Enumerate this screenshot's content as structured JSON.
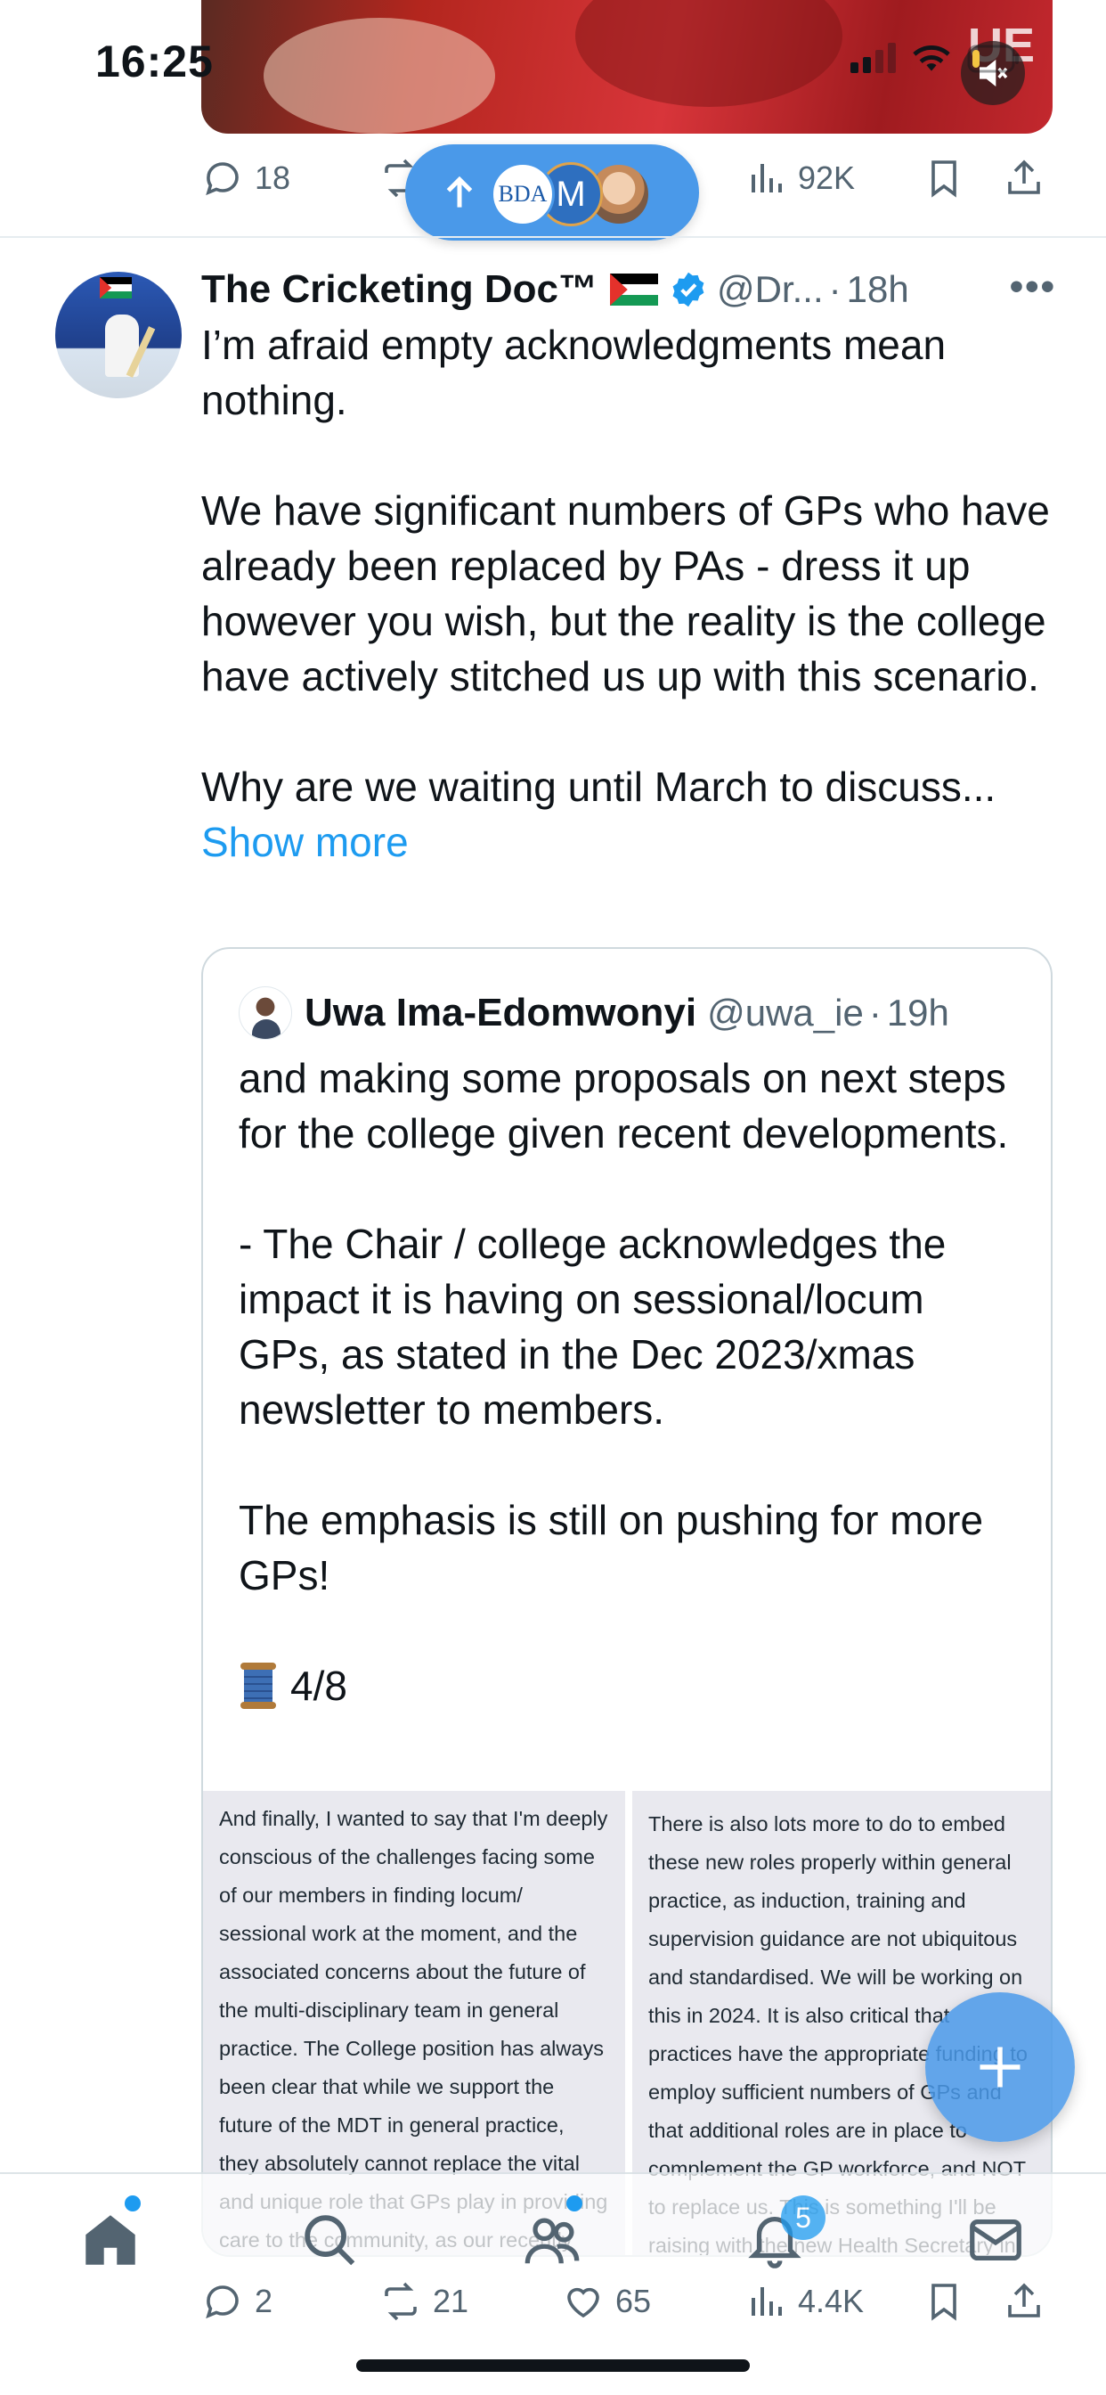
{
  "status_bar": {
    "time": "16:25"
  },
  "top_media": {
    "overlay_text": "UE"
  },
  "prev_actions": {
    "replies": "18",
    "reposts": "",
    "views": "92K"
  },
  "new_posts_pill": {
    "avatar1_text": "BDA",
    "avatar2_text": "M"
  },
  "tweet": {
    "display_name": "The Cricketing Doc™",
    "handle": "@Dr...",
    "separator": "·",
    "time": "18h",
    "more": "•••",
    "paragraphs": [
      "I’m afraid empty acknowledgments mean nothing.",
      "We have significant numbers of GPs who have already been replaced by PAs - dress it up however you wish, but the reality is the college have actively stitched us up with this scenario.",
      "Why are we waiting until March to discuss..."
    ],
    "show_more": "Show more"
  },
  "quote": {
    "display_name": "Uwa Ima-Edomwonyi",
    "handle": "@uwa_ie",
    "separator": "·",
    "time": "19h",
    "paragraphs": [
      "and making some proposals on next steps for the college given recent developments.",
      "- The Chair / college acknowledges the impact it is having on sessional/locum GPs, as stated in the Dec 2023/xmas newsletter to members.",
      "The emphasis is still on pushing for more GPs!"
    ],
    "thread_count": "4/8",
    "image_left_text": "And finally, I wanted to say that I'm deeply conscious of the challenges facing some of our members in finding locum/ sessional work at the moment, and the associated concerns about the future of the multi-disciplinary team in general practice. The College position has always been clear that while we support the future of the MDT in general practice, they absolutely cannot replace the vital and unique role that GPs play in providing care to the community, as our recently Council-approved definition of",
    "image_right_text": "There is also lots more to do to embed these new roles properly within general practice, as induction, training and supervision guidance are not ubiquitous and standardised. We will be working on this in 2024. It is also critical that practices have the appropriate funding to employ sufficient numbers of GPs and that additional roles are in place to complement the GP workforce, and NOT to replace us. This is something I'll be raising with the new Health Secretary in the New Year"
  },
  "tweet_actions": {
    "replies": "2",
    "reposts": "21",
    "likes": "65",
    "views": "4.4K"
  },
  "tabbar": {
    "notifications_badge": "5"
  },
  "colors": {
    "accent": "#1d9bf0",
    "pill": "#4a99e9",
    "text_primary": "#0f1419",
    "text_secondary": "#536471",
    "border": "#cfd9de"
  },
  "icons": [
    "mute-icon",
    "signal-icon",
    "wifi-icon",
    "battery-icon",
    "reply-icon",
    "repost-icon",
    "views-icon",
    "bookmark-icon",
    "share-icon",
    "like-icon",
    "verified-icon",
    "more-icon",
    "compose-icon",
    "home-icon",
    "search-icon",
    "communities-icon",
    "notifications-icon",
    "messages-icon"
  ]
}
